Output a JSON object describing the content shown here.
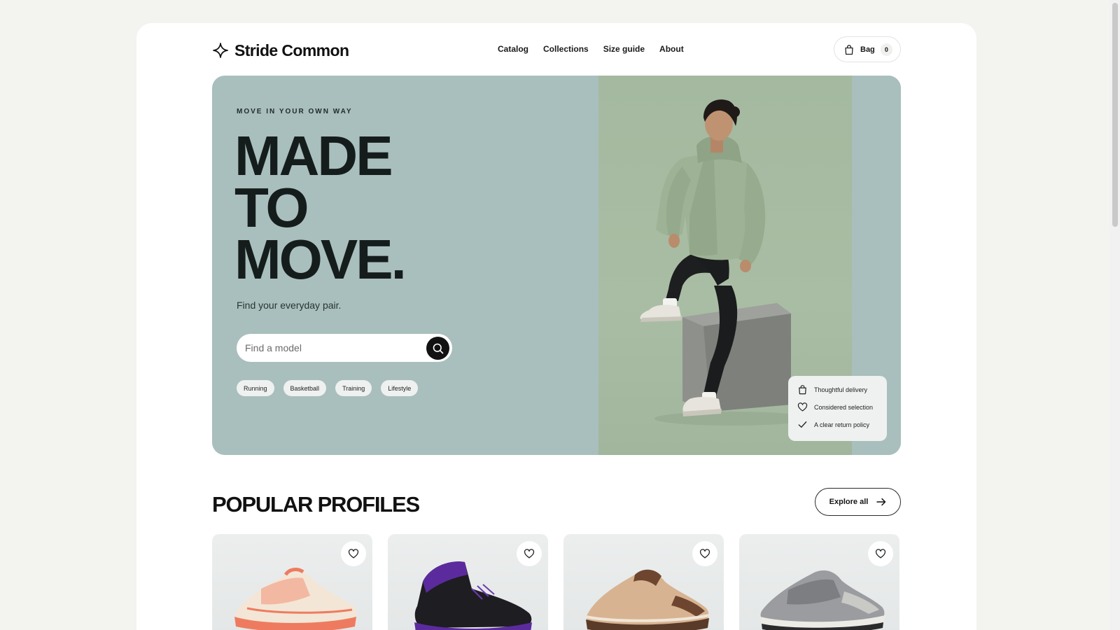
{
  "brand": {
    "name": "Stride Common",
    "logo_icon": "sparkle-star-icon"
  },
  "nav": {
    "items": [
      "Catalog",
      "Collections",
      "Size guide",
      "About"
    ]
  },
  "bag": {
    "label": "Bag",
    "count": "0",
    "icon": "shopping-bag-icon"
  },
  "hero": {
    "eyebrow": "MOVE IN YOUR OWN WAY",
    "headline": [
      "MADE",
      "TO",
      "MOVE."
    ],
    "subline": "Find your everyday pair.",
    "search_placeholder": "Find a model",
    "search_value": "",
    "chips": [
      "Running",
      "Basketball",
      "Training",
      "Lifestyle"
    ],
    "bg_color": "#a9bfbd",
    "badges": [
      {
        "icon": "shopping-bag-icon",
        "text": "Thoughtful delivery"
      },
      {
        "icon": "heart-icon",
        "text": "Considered selection"
      },
      {
        "icon": "check-icon",
        "text": "A clear return policy"
      }
    ]
  },
  "popular": {
    "title": "POPULAR PROFILES",
    "explore_label": "Explore all",
    "cards": [
      {
        "shoe": "coral-running-shoe"
      },
      {
        "shoe": "black-purple-basketball-shoe"
      },
      {
        "shoe": "tan-brown-trail-shoe"
      },
      {
        "shoe": "grey-retro-runner"
      }
    ]
  }
}
